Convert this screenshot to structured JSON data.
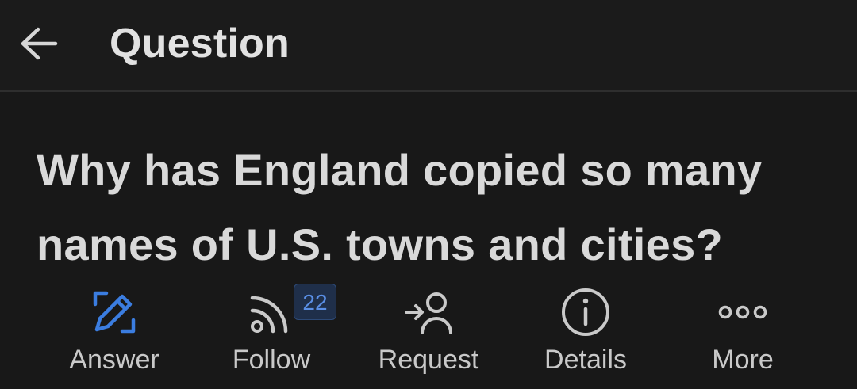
{
  "header": {
    "back_icon": "arrow-left-icon",
    "title": "Question"
  },
  "question": {
    "title": "Why has England copied so many names of U.S. towns and cities?"
  },
  "actions": [
    {
      "label": "Answer",
      "icon": "pencil-edit-icon",
      "color": "#3b7de0"
    },
    {
      "label": "Follow",
      "icon": "rss-follow-icon",
      "badge": "22"
    },
    {
      "label": "Request",
      "icon": "request-person-icon"
    },
    {
      "label": "Details",
      "icon": "info-icon"
    },
    {
      "label": "More",
      "icon": "more-dots-icon"
    }
  ],
  "colors": {
    "background": "#181818",
    "accent": "#3b7de0",
    "text": "#d9d9d9",
    "badge_bg": "#1f2f4a",
    "badge_text": "#5a8fe6"
  }
}
